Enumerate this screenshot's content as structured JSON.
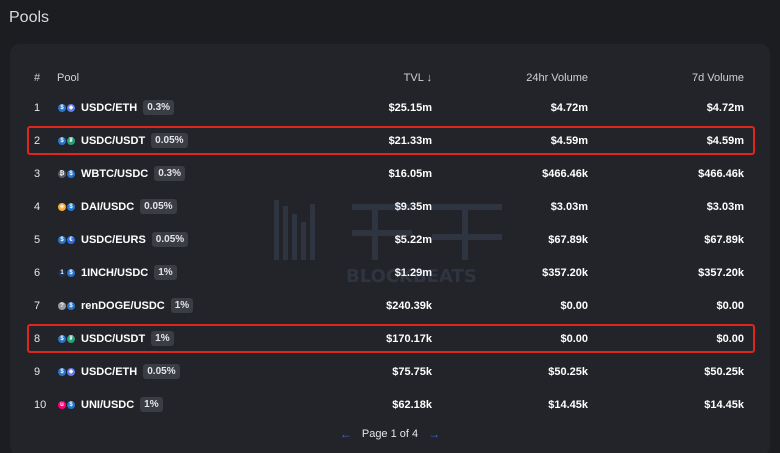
{
  "page": {
    "title": "Pools"
  },
  "table": {
    "headers": {
      "index": "#",
      "pool": "Pool",
      "tvl": "TVL ↓",
      "vol24": "24hr Volume",
      "vol7": "7d Volume"
    },
    "rows": [
      {
        "index": "1",
        "pool": "USDC/ETH",
        "fee": "0.3%",
        "tvl": "$25.15m",
        "vol24": "$4.72m",
        "vol7": "$4.72m",
        "tokens": [
          "usdc",
          "eth"
        ],
        "highlight": false
      },
      {
        "index": "2",
        "pool": "USDC/USDT",
        "fee": "0.05%",
        "tvl": "$21.33m",
        "vol24": "$4.59m",
        "vol7": "$4.59m",
        "tokens": [
          "usdc",
          "usdt"
        ],
        "highlight": true
      },
      {
        "index": "3",
        "pool": "WBTC/USDC",
        "fee": "0.3%",
        "tvl": "$16.05m",
        "vol24": "$466.46k",
        "vol7": "$466.46k",
        "tokens": [
          "wbtc",
          "usdc"
        ],
        "highlight": false
      },
      {
        "index": "4",
        "pool": "DAI/USDC",
        "fee": "0.05%",
        "tvl": "$9.35m",
        "vol24": "$3.03m",
        "vol7": "$3.03m",
        "tokens": [
          "dai",
          "usdc"
        ],
        "highlight": false
      },
      {
        "index": "5",
        "pool": "USDC/EURS",
        "fee": "0.05%",
        "tvl": "$5.22m",
        "vol24": "$67.89k",
        "vol7": "$67.89k",
        "tokens": [
          "usdc",
          "eurs"
        ],
        "highlight": false
      },
      {
        "index": "6",
        "pool": "1INCH/USDC",
        "fee": "1%",
        "tvl": "$1.29m",
        "vol24": "$357.20k",
        "vol7": "$357.20k",
        "tokens": [
          "1inch",
          "usdc"
        ],
        "highlight": false
      },
      {
        "index": "7",
        "pool": "renDOGE/USDC",
        "fee": "1%",
        "tvl": "$240.39k",
        "vol24": "$0.00",
        "vol7": "$0.00",
        "tokens": [
          "unknown",
          "usdc"
        ],
        "highlight": false
      },
      {
        "index": "8",
        "pool": "USDC/USDT",
        "fee": "1%",
        "tvl": "$170.17k",
        "vol24": "$0.00",
        "vol7": "$0.00",
        "tokens": [
          "usdc",
          "usdt"
        ],
        "highlight": true
      },
      {
        "index": "9",
        "pool": "USDC/ETH",
        "fee": "0.05%",
        "tvl": "$75.75k",
        "vol24": "$50.25k",
        "vol7": "$50.25k",
        "tokens": [
          "usdc",
          "eth"
        ],
        "highlight": false
      },
      {
        "index": "10",
        "pool": "UNI/USDC",
        "fee": "1%",
        "tvl": "$62.18k",
        "vol24": "$14.45k",
        "vol7": "$14.45k",
        "tokens": [
          "uni",
          "usdc"
        ],
        "highlight": false
      }
    ]
  },
  "pagination": {
    "prev": "←",
    "label": "Page 1 of 4",
    "next": "→"
  },
  "watermark": {
    "text": "BLOCKBEATS"
  },
  "colors": {
    "highlight": "#e0251b",
    "usdc": "#2775ca",
    "eth": "#627eea",
    "usdt": "#26a17b",
    "wbtc": "#5a5a66",
    "dai": "#f5ac37",
    "eurs": "#2f6fe0",
    "1inch": "#1b314f",
    "uni": "#ff007a",
    "unknown": "#9a9aa0"
  }
}
